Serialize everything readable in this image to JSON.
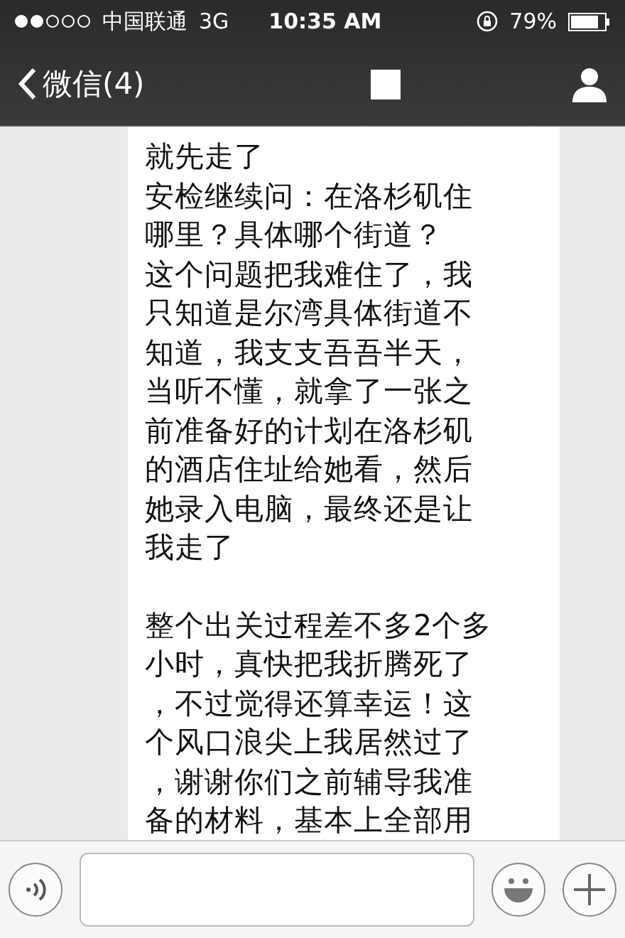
{
  "status_bar": {
    "carrier": "中国联通",
    "network": "3G",
    "time": "10:35 AM",
    "battery": "79%"
  },
  "nav_bar": {
    "back_label": "微信(4)"
  },
  "message": {
    "paragraphs": [
      {
        "lines": [
          "就先走了",
          "安检继续问：在洛杉矶住",
          "哪里？具体哪个街道？",
          "这个问题把我难住了，我",
          "只知道是尔湾具体街道不",
          "知道，我支支吾吾半天，",
          "当听不懂，就拿了一张之",
          "前准备好的计划在洛杉矶",
          "的酒店住址给她看，然后",
          "她录入电脑，最终还是让",
          "我走了"
        ]
      },
      {
        "lines": [
          "整个出关过程差不多2个多",
          "小时，真快把我折腾死了",
          "，不过觉得还算幸运！这",
          "个风口浪尖上我居然过了",
          "，谢谢你们之前辅导我准",
          "备的材料，基本上全部用"
        ]
      }
    ]
  }
}
